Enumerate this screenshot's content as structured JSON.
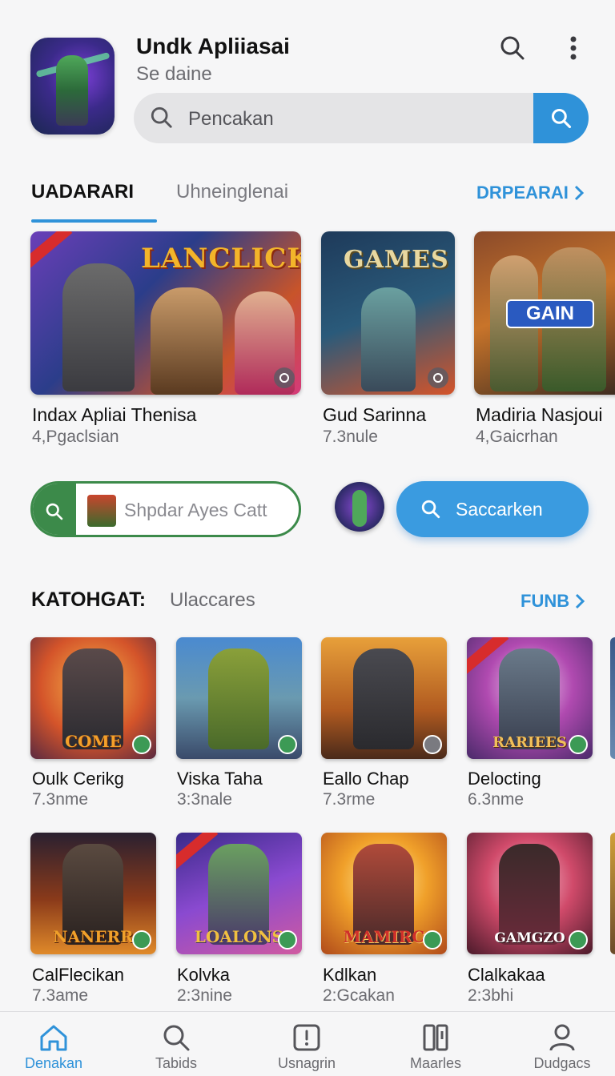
{
  "header": {
    "title": "Undk Apliiasai",
    "subtitle": "Se daine",
    "search_placeholder": "Pencakan",
    "icons": [
      "search-icon",
      "more-vertical-icon"
    ]
  },
  "tabs": {
    "active": "UADARARI",
    "inactive": "Uhneinglenai",
    "see_more": "DRPEARAI"
  },
  "featured": [
    {
      "title": "Indax Apliai Thenisa",
      "subtitle": "4,Pgaclsian",
      "art_text": "LANCLICK"
    },
    {
      "title": "Gud Sarinna",
      "subtitle": "7.3nule",
      "art_text": "GAMES"
    },
    {
      "title": "Madiria Nasjoui",
      "subtitle": "4,Gaicrhan",
      "art_text": "GAIN"
    }
  ],
  "mid_row": {
    "pill_search_text": "Shpdar Ayes Catt",
    "blue_search_label": "Saccarken"
  },
  "section": {
    "title": "KATOHGAT:",
    "subtitle": "Ulaccares",
    "see_more": "FUNB"
  },
  "grid_row1": [
    {
      "title": "Oulk Cerikg",
      "subtitle": "7.3nme",
      "art_text": "COME"
    },
    {
      "title": "Viska Taha",
      "subtitle": "3:3nale",
      "art_text": ""
    },
    {
      "title": "Eallo Chap",
      "subtitle": "7.3rme",
      "art_text": ""
    },
    {
      "title": "Delocting",
      "subtitle": "6.3nme",
      "art_text": "RARIEES"
    }
  ],
  "grid_row2": [
    {
      "title": "CalFlecikan",
      "subtitle": "7.3ame",
      "art_text": "NANERR"
    },
    {
      "title": "Kolvka",
      "subtitle": "2:3nine",
      "art_text": "LOALONS"
    },
    {
      "title": "Kdlkan",
      "subtitle": "2:Gcakan",
      "art_text": "MAMIRC"
    },
    {
      "title": "Clalkakaa",
      "subtitle": "2:3bhi",
      "art_text": "GAMGZO"
    }
  ],
  "bottom_nav": [
    {
      "label": "Denakan",
      "icon": "home-icon",
      "active": true
    },
    {
      "label": "Tabids",
      "icon": "search-icon",
      "active": false
    },
    {
      "label": "Usnagrin",
      "icon": "apps-icon",
      "active": false
    },
    {
      "label": "Maarles",
      "icon": "library-icon",
      "active": false
    },
    {
      "label": "Dudgacs",
      "icon": "profile-icon",
      "active": false
    }
  ],
  "colors": {
    "accent": "#2f92d9",
    "green": "#3c8a4a",
    "background": "#f6f6f7"
  }
}
